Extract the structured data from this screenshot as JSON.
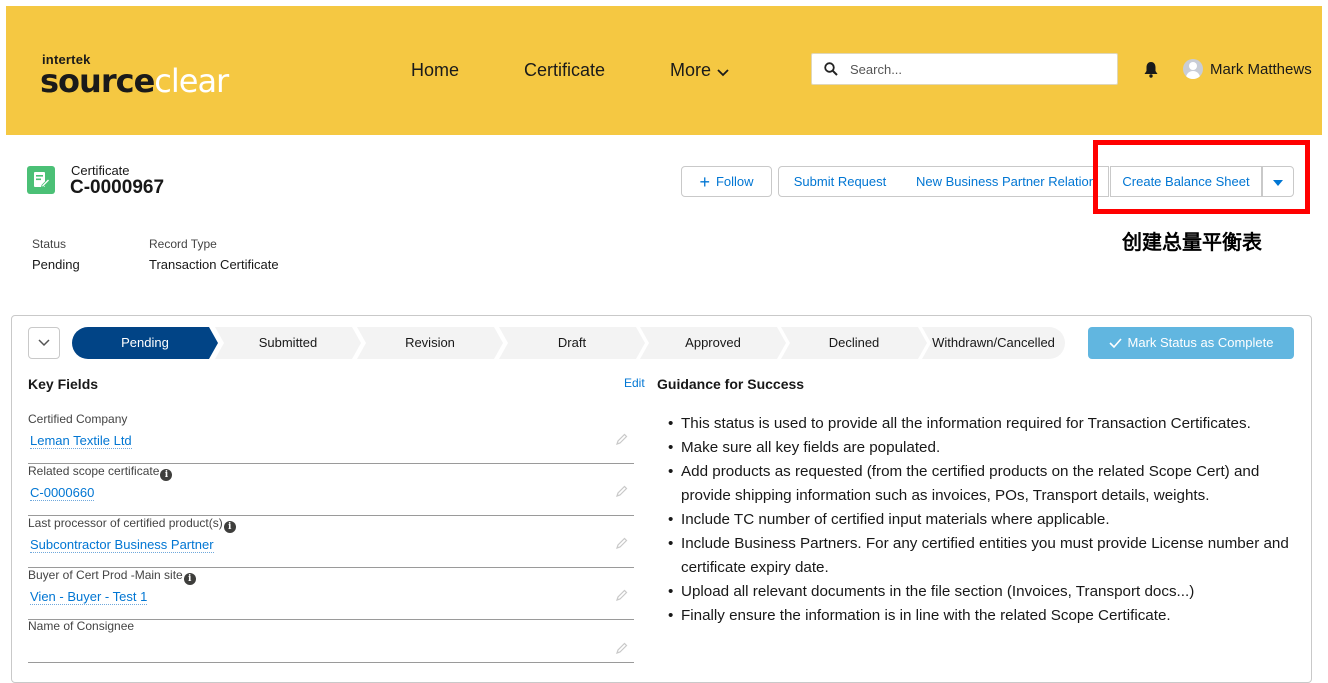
{
  "header": {
    "logo_small": "intertek",
    "logo_part1": "source",
    "logo_part2": "clear",
    "nav": {
      "home": "Home",
      "certificate": "Certificate",
      "more": "More"
    },
    "search_placeholder": "Search...",
    "user_name": "Mark Matthews",
    "bar_color": "#f5c842"
  },
  "record": {
    "type": "Certificate",
    "name": "C-0000967",
    "fields": {
      "status_label": "Status",
      "status_value": "Pending",
      "record_type_label": "Record Type",
      "record_type_value": "Transaction Certificate"
    }
  },
  "actions": {
    "follow": "Follow",
    "submit_request": "Submit Request",
    "new_business_partner": "New Business Partner Relation",
    "create_balance_sheet": "Create Balance Sheet"
  },
  "annotation": "创建总量平衡表",
  "path": {
    "steps": [
      "Pending",
      "Submitted",
      "Revision",
      "Draft",
      "Approved",
      "Declined",
      "Withdrawn/Cancelled"
    ],
    "active_step": "Pending",
    "mark_complete": "Mark Status as Complete"
  },
  "key_fields": {
    "title": "Key Fields",
    "edit": "Edit",
    "fields": [
      {
        "label": "Certified Company",
        "value": "Leman Textile Ltd",
        "info": false
      },
      {
        "label": "Related scope certificate",
        "value": "C-0000660",
        "info": true
      },
      {
        "label": "Last processor of certified product(s)",
        "value": "Subcontractor Business Partner",
        "info": true
      },
      {
        "label": "Buyer of Cert Prod -Main site",
        "value": "Vien - Buyer - Test 1",
        "info": true
      },
      {
        "label": "Name of Consignee",
        "value": "",
        "info": false
      }
    ]
  },
  "guidance": {
    "title": "Guidance for Success",
    "items": [
      "This status is used to provide all the information required for Transaction Certificates.",
      "Make sure all key fields are populated.",
      "Add products as requested (from the certified products on the related Scope Cert) and provide shipping information such as invoices, POs, Transport details, weights.",
      "Include TC number of certified input materials where applicable.",
      "Include Business Partners. For any certified entities you must provide License number and certificate expiry date.",
      "Upload all relevant documents in the file section (Invoices, Transport docs...)",
      "Finally ensure the information is in line with the related Scope Certificate."
    ]
  }
}
